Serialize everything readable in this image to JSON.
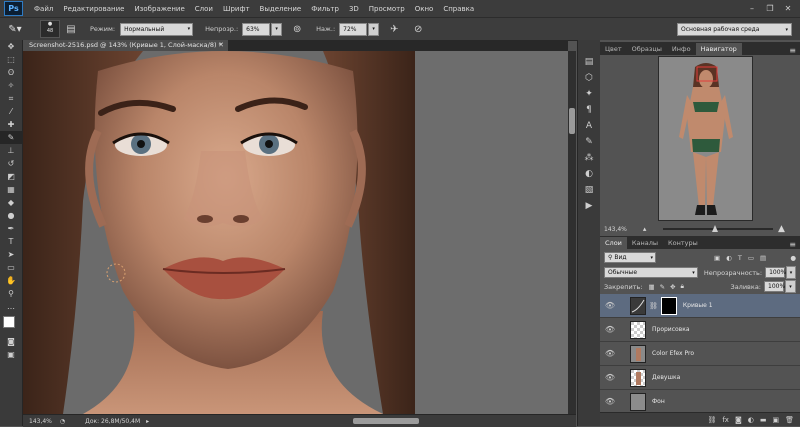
{
  "app": {
    "logo": "Ps"
  },
  "menu": [
    "Файл",
    "Редактирование",
    "Изображение",
    "Слои",
    "Шрифт",
    "Выделение",
    "Фильтр",
    "3D",
    "Просмотр",
    "Окно",
    "Справка"
  ],
  "window_controls": [
    "minimize-icon",
    "restore-icon",
    "close-icon"
  ],
  "options": {
    "brush_size": "48",
    "mode_label": "Режим:",
    "mode_value": "Нормальный",
    "opacity_label": "Непрозр.:",
    "opacity_value": "63%",
    "flow_label": "Наж.:",
    "flow_value": "72%",
    "workspace": "Основная рабочая среда"
  },
  "document": {
    "tab_title": "Screenshot-2516.psd @ 143% (Кривые 1, Слой-маска/8) *",
    "zoom": "143,4%",
    "doc_size": "Док: 26,8M/50,4M"
  },
  "navigator": {
    "tabs": [
      "Цвет",
      "Образцы",
      "Инфо",
      "Навигатор"
    ],
    "active_tab": "Навигатор",
    "zoom": "143,4%"
  },
  "layers": {
    "tabs": [
      "Слои",
      "Каналы",
      "Контуры"
    ],
    "active_tab": "Слои",
    "filter_value": "Вид",
    "blend_mode": "Обычные",
    "opacity_label": "Непрозрачность:",
    "opacity_value": "100%",
    "lock_label": "Закрепить:",
    "fill_label": "Заливка:",
    "fill_value": "100%",
    "items": [
      {
        "name": "Кривые 1",
        "selected": true
      },
      {
        "name": "Прорисовка",
        "selected": false
      },
      {
        "name": "Color Efex Pro",
        "selected": false
      },
      {
        "name": "Девушка",
        "selected": false
      },
      {
        "name": "Фон",
        "selected": false
      }
    ]
  },
  "colors": {
    "accent_selected": "#5d6b80",
    "panel": "#535353",
    "dark": "#3a3a3a"
  }
}
